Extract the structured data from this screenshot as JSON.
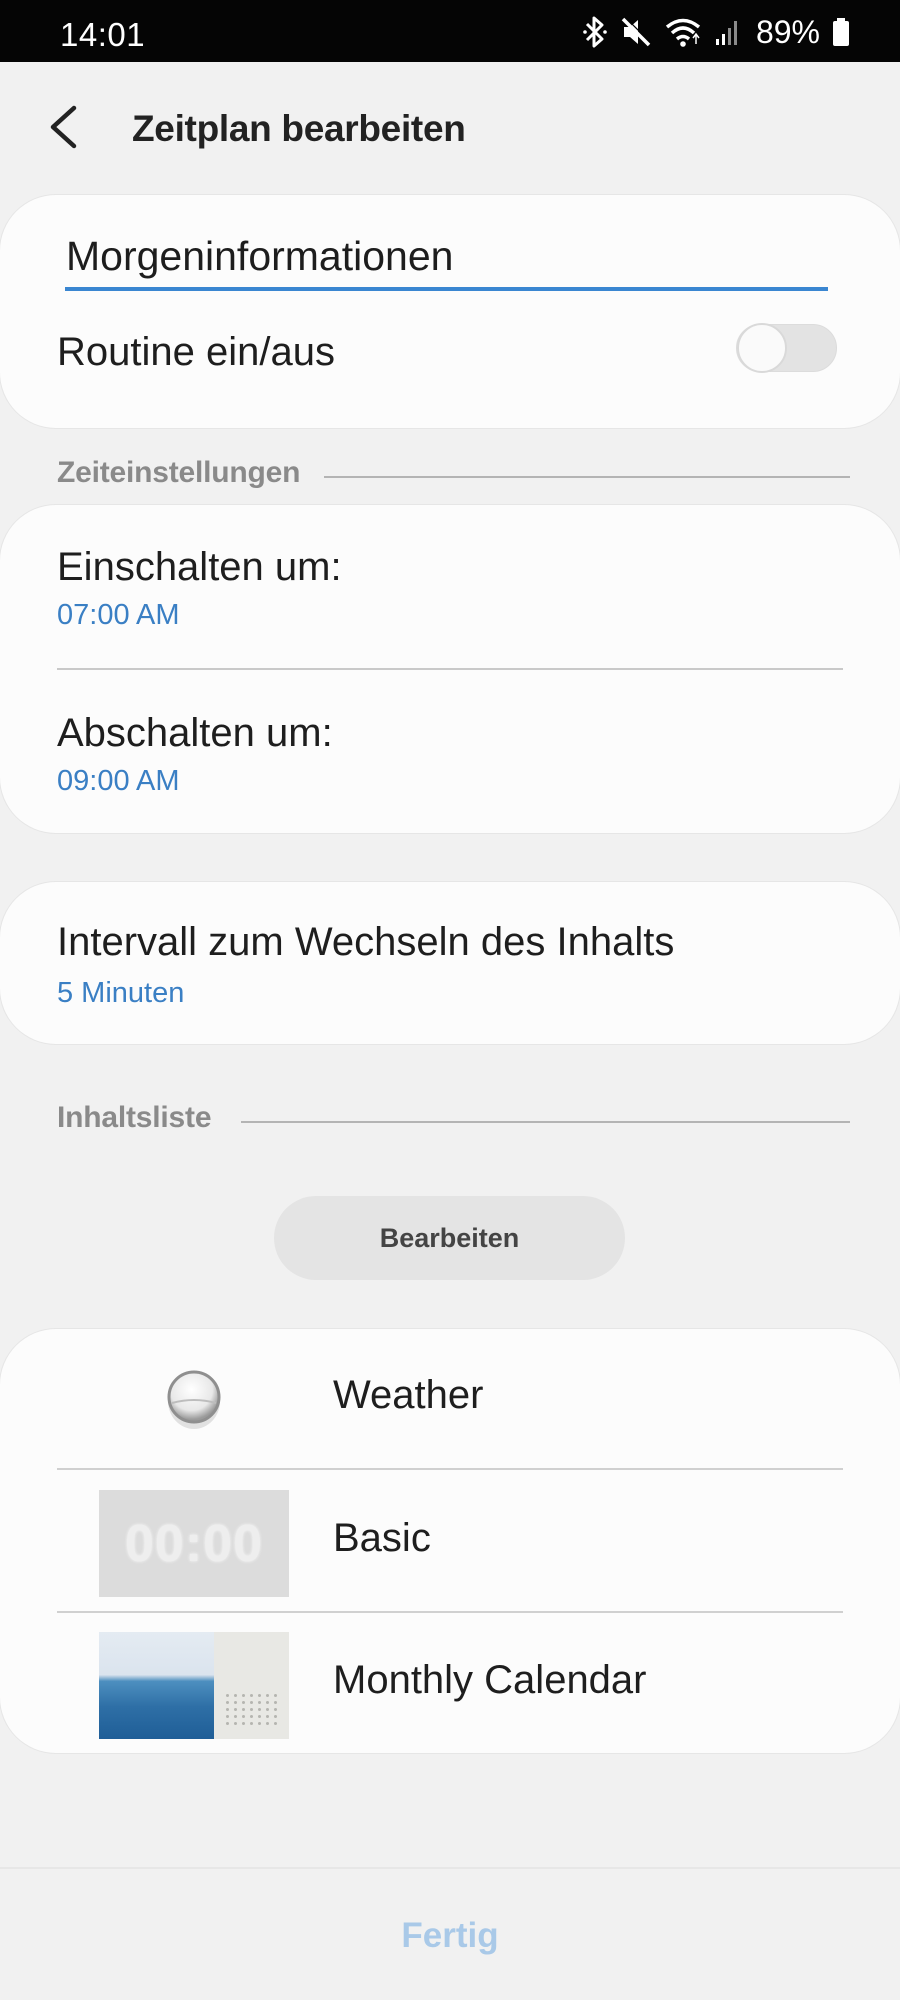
{
  "status_bar": {
    "time": "14:01",
    "battery": "89%",
    "icons": [
      "bluetooth-icon",
      "mute-icon",
      "wifi-icon",
      "signal-icon",
      "battery-icon"
    ]
  },
  "header": {
    "back_icon": "chevron-left-icon",
    "title": "Zeitplan bearbeiten"
  },
  "name_card": {
    "name_value": "Morgeninformationen",
    "toggle_label": "Routine ein/aus",
    "toggle_on": false
  },
  "time_section": {
    "title": "Zeiteinstellungen",
    "on_label": "Einschalten um:",
    "on_value": "07:00 AM",
    "off_label": "Abschalten um:",
    "off_value": "09:00 AM"
  },
  "interval": {
    "label": "Intervall zum Wechseln des Inhalts",
    "value": "5 Minuten"
  },
  "content_section": {
    "title": "Inhaltsliste",
    "edit_button": "Bearbeiten",
    "items": [
      {
        "label": "Weather",
        "thumb": "weather-droplet"
      },
      {
        "label": "Basic",
        "thumb": "basic-clock",
        "thumb_text": "00:00"
      },
      {
        "label": "Monthly Calendar",
        "thumb": "sea-calendar"
      }
    ]
  },
  "footer": {
    "done_button": "Fertig"
  },
  "colors": {
    "accent_blue": "#3a7fc4",
    "input_underline": "#3a86d1",
    "done_disabled": "#a9c9e8",
    "background": "#f1f1f1",
    "card": "#fcfcfc"
  }
}
